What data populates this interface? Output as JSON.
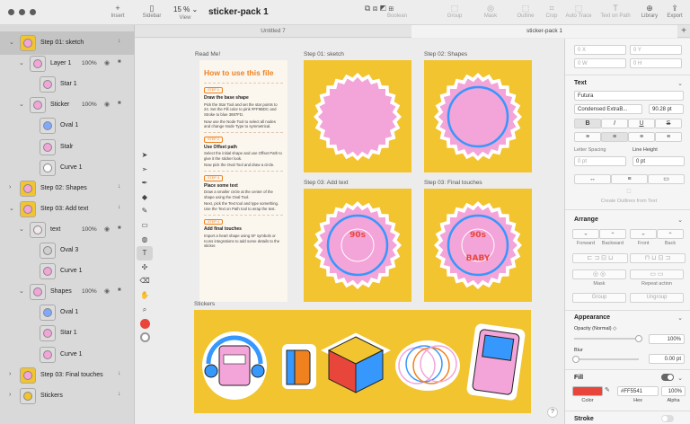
{
  "toolbar": {
    "insert": "Insert",
    "sidebar": "Sidebar",
    "zoom_value": "15 %",
    "view": "View",
    "doc_title": "sticker-pack 1",
    "boolean": "Boolean",
    "group": "Group",
    "mask": "Mask",
    "outline": "Outline",
    "crop": "Crop",
    "auto_trace": "Auto Trace",
    "text_on_path": "Text on Path",
    "library": "Library",
    "export": "Export"
  },
  "tabs": [
    "Untitled 7",
    "sticker-pack 1"
  ],
  "layers": [
    {
      "name": "Step 01: sketch",
      "indent": 0,
      "chev": "⌄",
      "thumb": "#f3a4d8",
      "frame": "#f2c42f",
      "sel": true,
      "act": "↓"
    },
    {
      "name": "Layer 1",
      "indent": 1,
      "chev": "⌄",
      "thumb": "#f3a4d8",
      "pct": "100%"
    },
    {
      "name": "Star 1",
      "indent": 2,
      "thumb": "#f3a4d8"
    },
    {
      "name": "Sticker",
      "indent": 1,
      "chev": "⌄",
      "thumb": "#f3a4d8",
      "pct": "100%"
    },
    {
      "name": "Oval 1",
      "indent": 2,
      "thumb": "#7fa8ff"
    },
    {
      "name": "Stalr",
      "indent": 2,
      "thumb": "#f3a4d8"
    },
    {
      "name": "Curve 1",
      "indent": 2,
      "thumb": "#ffffff"
    },
    {
      "name": "Step 02: Shapes",
      "indent": 0,
      "chev": "›",
      "thumb": "#f3a4d8",
      "frame": "#f2c42f",
      "act": "↓"
    },
    {
      "name": "Step 03: Add text",
      "indent": 0,
      "chev": "⌄",
      "thumb": "#f3a4d8",
      "frame": "#f2c42f",
      "act": "↓"
    },
    {
      "name": "text",
      "indent": 1,
      "chev": "⌄",
      "thumb": "#f3e8e8",
      "pct": "100%"
    },
    {
      "name": "Oval 3",
      "indent": 2,
      "thumb": "#cfcfcf"
    },
    {
      "name": "Curve 1",
      "indent": 2,
      "thumb": "#f3a4d8"
    },
    {
      "name": "Shapes",
      "indent": 1,
      "chev": "⌄",
      "thumb": "#f3a4d8",
      "pct": "100%"
    },
    {
      "name": "Oval 1",
      "indent": 2,
      "thumb": "#7fa8ff"
    },
    {
      "name": "Star 1",
      "indent": 2,
      "thumb": "#f3a4d8"
    },
    {
      "name": "Curve 1",
      "indent": 2,
      "thumb": "#f3a4d8"
    },
    {
      "name": "Step 03: Final touches",
      "indent": 0,
      "chev": "›",
      "thumb": "#f3a4d8",
      "frame": "#f2c42f",
      "act": "↓"
    },
    {
      "name": "Stickers",
      "indent": 0,
      "chev": "›",
      "thumb": "#f2c42f",
      "act": "↓"
    }
  ],
  "readme": {
    "label": "Read Me!",
    "title": "How to use this file",
    "steps": [
      {
        "badge": "STEP 1",
        "heading": "Draw the base shape",
        "body": [
          "Pick the Star Tool and set the star points to 24. Set the Fill color to pink #FF9BDC and Stroke to blue 3697FD.",
          "Now use the Node Tool to select all nodes and change Node Type to symmetrical."
        ]
      },
      {
        "badge": "STEP 2",
        "heading": "Use Offset path",
        "body": [
          "Select the initial shape and use Offset Path to give it the sticker look.",
          "Now pick the Oval Tool and draw a circle."
        ]
      },
      {
        "badge": "STEP 3",
        "heading": "Place some text",
        "body": [
          "Draw a smaller circle at the center of the shape using the Oval Tool.",
          "Next, pick the Text tool and type something. Use the Text on Path tool to wrap the text."
        ]
      },
      {
        "badge": "STEP 4",
        "heading": "Add final touches",
        "body": [
          "Import a heart shape using SF symbols or Icons integrations to add some details to the sticker."
        ]
      }
    ]
  },
  "artboards": {
    "step01": "Step 01: sketch",
    "step02": "Step 02: Shapes",
    "step03": "Step 03: Add text",
    "step03b": "Step 03: Final touches",
    "stickers": "Stickers",
    "text_top": "90s",
    "text_bottom": "BABY"
  },
  "inspector": {
    "x": "0 X",
    "y": "0 Y",
    "w": "0 W",
    "h": "0 H",
    "text_header": "Text",
    "font": "Futura",
    "style": "Condensed ExtraB...",
    "size": "90.28 pt",
    "letter_spacing_label": "Letter Spacing",
    "line_height_label": "Line Height",
    "letter_spacing": "0 pt",
    "line_height": "0 pt",
    "create_outlines": "Create Outlines from Text",
    "arrange_header": "Arrange",
    "forward": "Forward",
    "backward": "Backward",
    "front": "Front",
    "back": "Back",
    "mask": "Mask",
    "repeat_action": "Repeat action",
    "group": "Group",
    "ungroup": "Ungroup",
    "appearance_header": "Appearance",
    "opacity_label": "Opacity (Normal) ◇",
    "opacity": "100%",
    "blur_label": "Blur",
    "blur": "0.00 pt",
    "fill_header": "Fill",
    "fill_hex": "#FF5541",
    "fill_alpha": "100%",
    "color_label": "Color",
    "hex_label": "Hex",
    "alpha_label": "Alpha",
    "stroke_header": "Stroke"
  },
  "colors": {
    "fill": "#e8463b",
    "board": "#f2c42f",
    "pink": "#f3a4d8",
    "blue": "#3697fd",
    "orange": "#f0811f"
  }
}
